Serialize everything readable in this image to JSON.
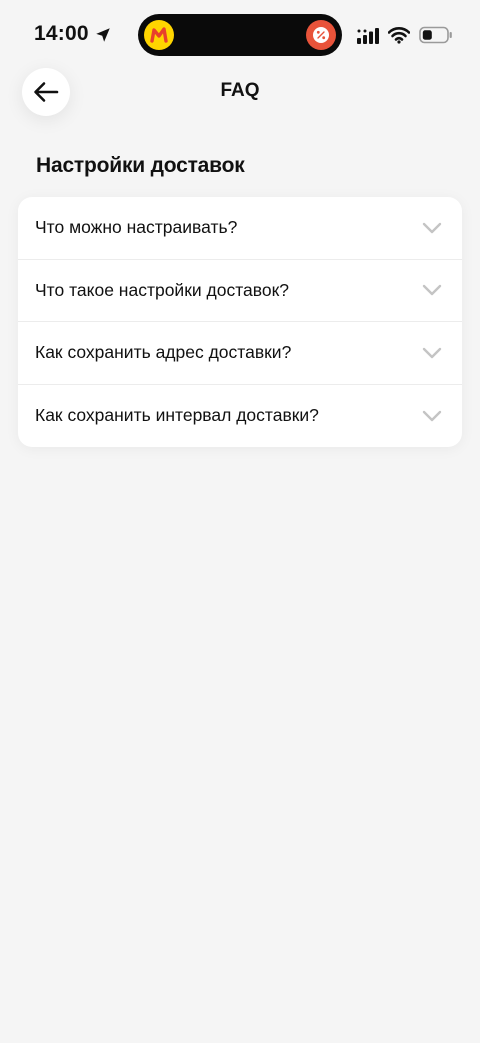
{
  "status_bar": {
    "time": "14:00"
  },
  "header": {
    "title": "FAQ"
  },
  "section": {
    "title": "Настройки доставок",
    "items": [
      {
        "question": "Что можно настраивать?"
      },
      {
        "question": "Что такое настройки доставок?"
      },
      {
        "question": "Как сохранить адрес доставки?"
      },
      {
        "question": "Как сохранить интервал доставки?"
      }
    ]
  },
  "colors": {
    "background": "#f5f5f5",
    "card": "#ffffff",
    "text": "#111111",
    "chevron": "#c4c4c4",
    "app_icon": "#ffd500",
    "promo_icon": "#e8533a"
  }
}
